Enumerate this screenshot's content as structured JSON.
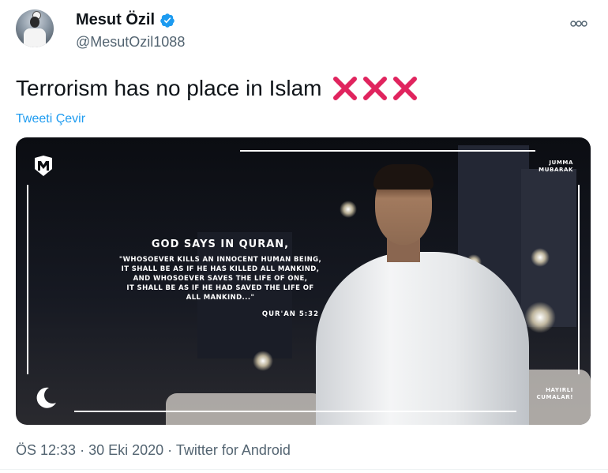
{
  "author": {
    "name": "Mesut Özil",
    "handle": "@MesutOzil1088",
    "verified": true,
    "avatar_icon": "profile-avatar"
  },
  "tweet": {
    "text": "Terrorism has no place in Islam",
    "emoji": [
      "cross-mark",
      "cross-mark",
      "cross-mark"
    ],
    "translate_label": "Tweeti Çevir"
  },
  "media": {
    "quote_title": "GOD SAYS IN QURAN,",
    "quote_lines": [
      "\"WHOSOEVER KILLS AN INNOCENT HUMAN BEING,",
      "IT SHALL BE AS IF HE HAS KILLED ALL MANKIND,",
      "AND WHOSOEVER SAVES THE LIFE OF ONE,",
      "IT SHALL BE AS IF HE HAD SAVED THE LIFE OF",
      "ALL MANKIND...\""
    ],
    "quote_ref": "QUR'AN 5:32",
    "corner_top_line1": "JUMMA",
    "corner_top_line2": "MUBARAK",
    "corner_bottom_line1": "HAYIRLI",
    "corner_bottom_line2": "CUMALAR!",
    "logo_icon": "m10-logo",
    "moon_icon": "crescent-moon-icon"
  },
  "footer": {
    "time": "ÖS 12:33",
    "separator": " · ",
    "date": "30 Eki 2020",
    "source": "Twitter for Android"
  },
  "colors": {
    "link": "#1d9bf0",
    "verified": "#1d9bf0",
    "cross": "#e0245e",
    "secondary_text": "#536471"
  }
}
